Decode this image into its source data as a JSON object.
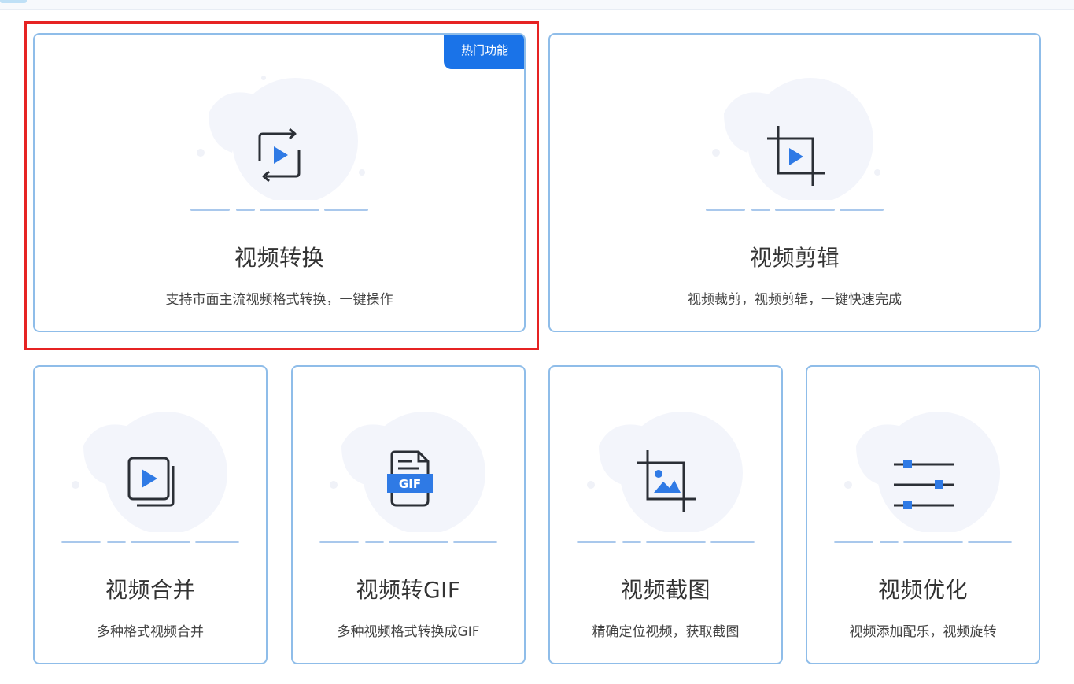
{
  "colors": {
    "accent": "#1a73e8",
    "card_border": "#8fbde9",
    "selection": "#e62323",
    "title_text": "#333333",
    "desc_text": "#444444"
  },
  "cards": [
    {
      "id": "convert",
      "title": "视频转换",
      "desc": "支持市面主流视频格式转换，一键操作",
      "badge": "热门功能",
      "icon": "video-convert-icon",
      "selected": true
    },
    {
      "id": "edit",
      "title": "视频剪辑",
      "desc": "视频裁剪，视频剪辑，一键快速完成",
      "icon": "video-crop-icon"
    },
    {
      "id": "merge",
      "title": "视频合并",
      "desc": "多种格式视频合并",
      "icon": "video-merge-icon"
    },
    {
      "id": "gif",
      "title": "视频转GIF",
      "desc": "多种视频格式转换成GIF",
      "icon": "gif-file-icon",
      "icon_label": "GIF"
    },
    {
      "id": "screenshot",
      "title": "视频截图",
      "desc": "精确定位视频，获取截图",
      "icon": "image-crop-icon"
    },
    {
      "id": "optimize",
      "title": "视频优化",
      "desc": "视频添加配乐，视频旋转",
      "icon": "sliders-icon"
    }
  ]
}
